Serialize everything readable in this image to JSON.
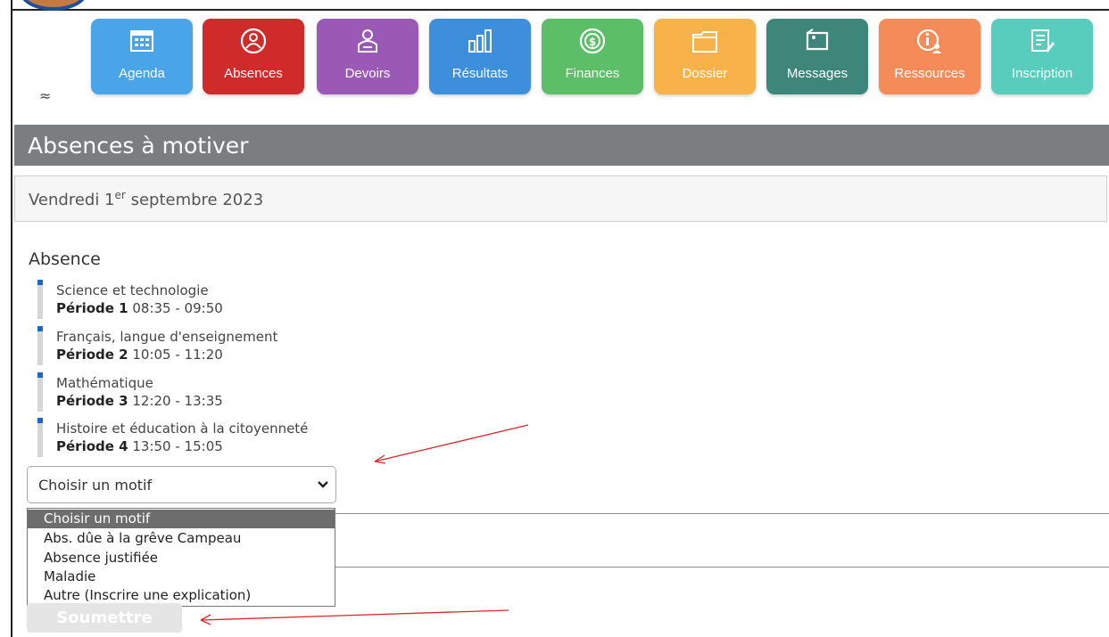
{
  "nav": {
    "tiles": [
      {
        "label": "Agenda",
        "color": "#4aa5e8",
        "icon": "calendar-icon"
      },
      {
        "label": "Absences",
        "color": "#cf2b2b",
        "icon": "person-icon"
      },
      {
        "label": "Devoirs",
        "color": "#9b59b6",
        "icon": "student-icon"
      },
      {
        "label": "Résultats",
        "color": "#3d8fdc",
        "icon": "bar-chart-icon"
      },
      {
        "label": "Finances",
        "color": "#5cbf67",
        "icon": "coin-icon"
      },
      {
        "label": "Dossier",
        "color": "#f7b24a",
        "icon": "folder-icon"
      },
      {
        "label": "Messages",
        "color": "#3e857a",
        "icon": "message-icon"
      },
      {
        "label": "Ressources",
        "color": "#f48b59",
        "icon": "info-person-icon"
      },
      {
        "label": "Inscription",
        "color": "#58cdbe",
        "icon": "form-icon"
      }
    ],
    "collapse_icon": "≈"
  },
  "page": {
    "title": "Absences à motiver",
    "date_prefix": "Vendredi 1",
    "date_sup": "er",
    "date_suffix": " septembre 2023"
  },
  "absence": {
    "title": "Absence",
    "items": [
      {
        "course": "Science et technologie",
        "period": "Période 1",
        "time": "08:35 - 09:50"
      },
      {
        "course": "Français, langue d'enseignement",
        "period": "Période 2",
        "time": "10:05 - 11:20"
      },
      {
        "course": "Mathématique",
        "period": "Période 3",
        "time": "12:20 - 13:35"
      },
      {
        "course": "Histoire et éducation à la citoyenneté",
        "period": "Période 4",
        "time": "13:50 - 15:05"
      }
    ]
  },
  "motif": {
    "selected": "Choisir un motif",
    "options": [
      "Choisir un motif",
      "Abs. dûe à la grêve Campeau",
      "Absence justifiée",
      "Maladie",
      "Autre (Inscrire une explication)"
    ]
  },
  "submit_label": "Soumettre",
  "colors": {
    "accent": "#1a66c9",
    "header": "#7b7e80",
    "annotation": "#d42a2a"
  }
}
